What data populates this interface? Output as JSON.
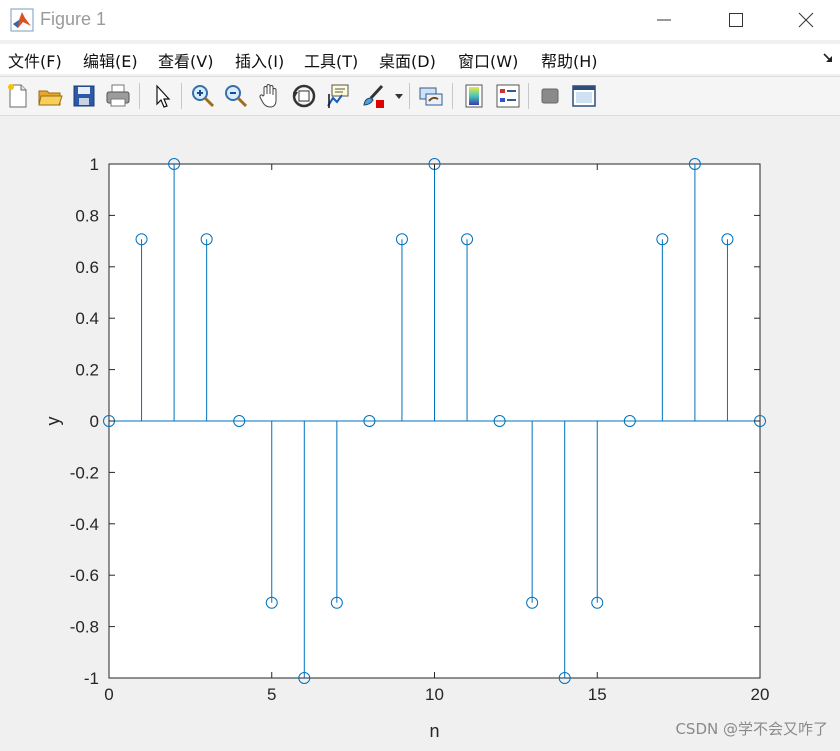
{
  "window": {
    "title": "Figure 1",
    "controls": [
      "minimize",
      "maximize",
      "close"
    ]
  },
  "menu": {
    "items": [
      "文件(F)",
      "编辑(E)",
      "查看(V)",
      "插入(I)",
      "工具(T)",
      "桌面(D)",
      "窗口(W)",
      "帮助(H)"
    ]
  },
  "toolbar": {
    "buttons": [
      "new-figure-icon",
      "open-file-icon",
      "save-icon",
      "print-icon",
      "select-pointer-icon",
      "zoom-in-icon",
      "zoom-out-icon",
      "pan-hand-icon",
      "rotate-3d-icon",
      "data-cursor-icon",
      "brush-icon",
      "link-plot-icon",
      "colorbar-icon",
      "legend-icon",
      "hide-plot-tools-icon",
      "show-plot-tools-icon"
    ]
  },
  "colors": {
    "stem": "#0072bd",
    "axes_background": "#ffffff",
    "figure_background": "#f0f0f0"
  },
  "chart_data": {
    "type": "stem",
    "title": "",
    "xlabel": "n",
    "ylabel": "y",
    "xlim": [
      0,
      20
    ],
    "ylim": [
      -1,
      1
    ],
    "xticks": [
      0,
      5,
      10,
      15,
      20
    ],
    "yticks": [
      -1,
      -0.8,
      -0.6,
      -0.4,
      -0.2,
      0,
      0.2,
      0.4,
      0.6,
      0.8,
      1
    ],
    "grid": false,
    "x": [
      0,
      1,
      2,
      3,
      4,
      5,
      6,
      7,
      8,
      9,
      10,
      11,
      12,
      13,
      14,
      15,
      16,
      17,
      18,
      19,
      20
    ],
    "y": [
      0,
      0.7071,
      1,
      0.7071,
      0,
      -0.7071,
      -1,
      -0.7071,
      0,
      0.7071,
      1,
      0.7071,
      0,
      -0.7071,
      -1,
      -0.7071,
      0,
      0.7071,
      1,
      0.7071,
      0
    ]
  },
  "watermark": "CSDN @学不会又咋了"
}
